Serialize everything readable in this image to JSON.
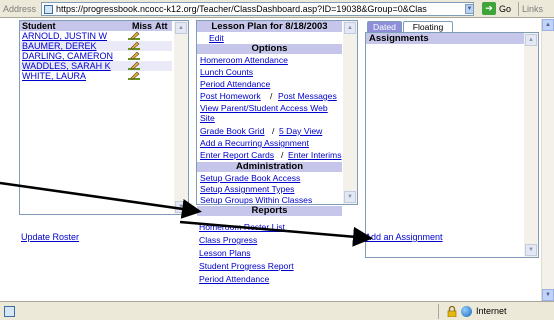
{
  "address_bar": {
    "label": "Address",
    "url": "https://progressbook.ncocc-k12.org/Teacher/ClassDashboard.asp?ID=19038&Group=0&Clas",
    "go_label": "Go",
    "links_label": "Links"
  },
  "roster": {
    "headers": {
      "student": "Student",
      "miss": "Miss",
      "att": "Att"
    },
    "students": [
      {
        "name": "ARNOLD, JUSTIN W"
      },
      {
        "name": "BAUMER, DEREK"
      },
      {
        "name": "DARLING, CAMERON"
      },
      {
        "name": "WADDLES, SARAH K"
      },
      {
        "name": "WHITE, LAURA"
      }
    ],
    "update_label": "Update Roster"
  },
  "lesson_plan": {
    "title": "Lesson Plan for 8/18/2003",
    "edit_label": "Edit",
    "sections": {
      "options": "Options",
      "administration": "Administration",
      "reports": "Reports"
    },
    "options_links": {
      "homeroom_attendance": "Homeroom Attendance",
      "lunch_counts": "Lunch Counts",
      "period_attendance": "Period Attendance",
      "post_homework": "Post Homework",
      "post_messages": "Post Messages",
      "view_parent_1": "View Parent/Student Access Web",
      "view_parent_2": "Site",
      "grade_book_grid": "Grade Book Grid",
      "five_day_view": "5 Day View",
      "add_recurring": "Add a Recurring Assignment",
      "enter_report_cards": "Enter Report Cards",
      "enter_interims": "Enter Interims",
      "separator": "/"
    },
    "admin_links": {
      "setup_grade_book": "Setup Grade Book Access",
      "setup_assignment_types": "Setup Assignment Types",
      "setup_groups": "Setup Groups Within Classes"
    },
    "report_links": {
      "homeroom_roster": "Homeroom Roster List",
      "class_progress": "Class Progress",
      "lesson_plans": "Lesson Plans",
      "student_progress": "Student Progress Report",
      "period_attendance": "Period Attendance"
    }
  },
  "assignments": {
    "tabs": {
      "dated": "Dated",
      "floating": "Floating"
    },
    "header": "Assignments",
    "add_label": "Add an Assignment"
  },
  "status_bar": {
    "zone_label": "Internet"
  },
  "colors": {
    "header_lavender": "#c6c6ea",
    "link_blue": "#0000cc",
    "active_tab": "#8f8fd9",
    "chrome": "#ece9d8"
  }
}
